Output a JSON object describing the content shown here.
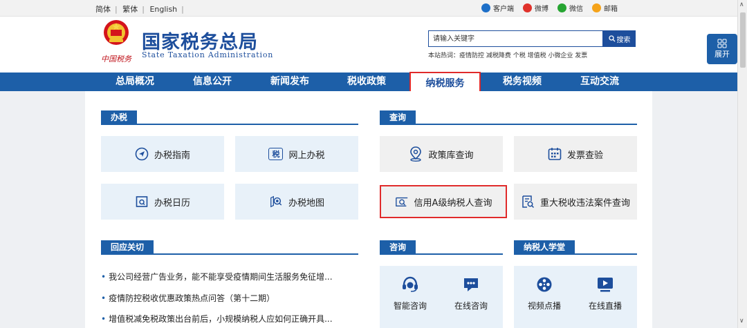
{
  "topbar": {
    "lang_simplified": "简体",
    "lang_traditional": "繁体",
    "lang_english": "English",
    "links": [
      {
        "label": "客户端",
        "icon": "client-icon",
        "color": "#1d6fc8"
      },
      {
        "label": "微博",
        "icon": "weibo-icon",
        "color": "#e0322b"
      },
      {
        "label": "微信",
        "icon": "wechat-icon",
        "color": "#27a532"
      },
      {
        "label": "邮箱",
        "icon": "mail-icon",
        "color": "#f5a31a"
      }
    ]
  },
  "header": {
    "title_cn": "国家税务总局",
    "title_en": "State Taxation Administration",
    "seal_text": "中国税务",
    "search_placeholder": "请输入关键字",
    "search_button": "搜索",
    "hot_words": "本站热词：疫情防控 减税降费 个税 增值税 小微企业 发票",
    "expand_label": "展开"
  },
  "nav": {
    "items": [
      "总局概况",
      "信息公开",
      "新闻发布",
      "税收政策",
      "纳税服务",
      "税务视频",
      "互动交流"
    ],
    "active": "纳税服务"
  },
  "sections": {
    "banshui": {
      "title": "办税",
      "tiles": [
        "办税指南",
        "网上办税",
        "办税日历",
        "办税地图"
      ],
      "badge": "税"
    },
    "chaxun": {
      "title": "查询",
      "tiles": [
        "政策库查询",
        "发票查验",
        "信用A级纳税人查询",
        "重大税收违法案件查询"
      ]
    },
    "huiying": {
      "title": "回应关切",
      "news": [
        "我公司经营广告业务，能不能享受疫情期间生活服务免征增...",
        "疫情防控税收优惠政策热点问答（第十二期）",
        "增值税减免税政策出台前后，小规模纳税人应如何正确开具..."
      ]
    },
    "zixun": {
      "title": "咨询",
      "items": [
        "智能咨询",
        "在线咨询"
      ]
    },
    "xuetang": {
      "title": "纳税人学堂",
      "items": [
        "视频点播",
        "在线直播"
      ]
    }
  },
  "colors": {
    "brand_blue": "#1d5fa8",
    "highlight_red": "#e02a2a",
    "tile_blue": "#e8f1f9",
    "tile_gray": "#f0f0f0"
  }
}
